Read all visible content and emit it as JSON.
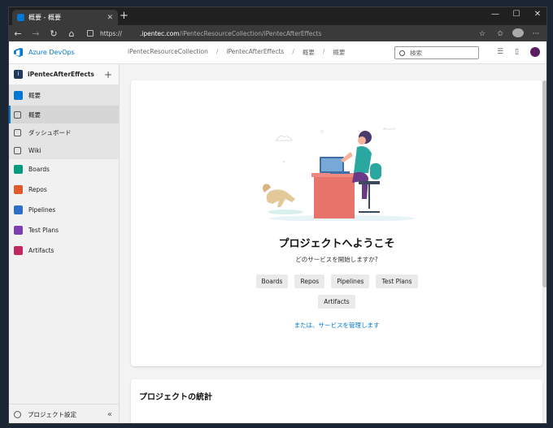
{
  "browser": {
    "tab_title": "概要 - 概要",
    "tab_close": "✕",
    "new_tab": "+",
    "minimize": "—",
    "maximize": "☐",
    "close": "✕",
    "url_protocol": "https://",
    "url_host": ".ipentec.com",
    "url_path": "/iPentecResourceCollection/iPentecAfterEffects"
  },
  "header": {
    "brand": "Azure DevOps",
    "breadcrumbs": [
      "iPentecResourceCollection",
      "iPentecAfterEffects",
      "概要",
      "概要"
    ],
    "breadcrumb_sep": "/",
    "search_placeholder": "検索"
  },
  "sidebar": {
    "project_initial": "i",
    "project_name": "iPentecAfterEffects",
    "add": "+",
    "items": [
      {
        "label": "概要",
        "icon": "overview-icon",
        "color": "#0078d4"
      },
      {
        "label": "概要",
        "icon": "summary-icon"
      },
      {
        "label": "ダッシュボード",
        "icon": "dashboard-icon"
      },
      {
        "label": "Wiki",
        "icon": "wiki-icon"
      },
      {
        "label": "Boards",
        "icon": "boards-icon",
        "color": "#009c7d"
      },
      {
        "label": "Repos",
        "icon": "repos-icon",
        "color": "#e05a2b"
      },
      {
        "label": "Pipelines",
        "icon": "pipelines-icon",
        "color": "#2c6fc9"
      },
      {
        "label": "Test Plans",
        "icon": "test-plans-icon",
        "color": "#7d3fb0"
      },
      {
        "label": "Artifacts",
        "icon": "artifacts-icon",
        "color": "#c2285f"
      }
    ],
    "footer_label": "プロジェクト設定",
    "collapse": "«"
  },
  "main": {
    "welcome_title": "プロジェクトへようこそ",
    "welcome_subtitle": "どのサービスを開始しますか?",
    "services_row1": [
      "Boards",
      "Repos",
      "Pipelines",
      "Test Plans"
    ],
    "services_row2": [
      "Artifacts"
    ],
    "manage_link": "または、サービスを管理します",
    "stats_title": "プロジェクトの統計"
  }
}
